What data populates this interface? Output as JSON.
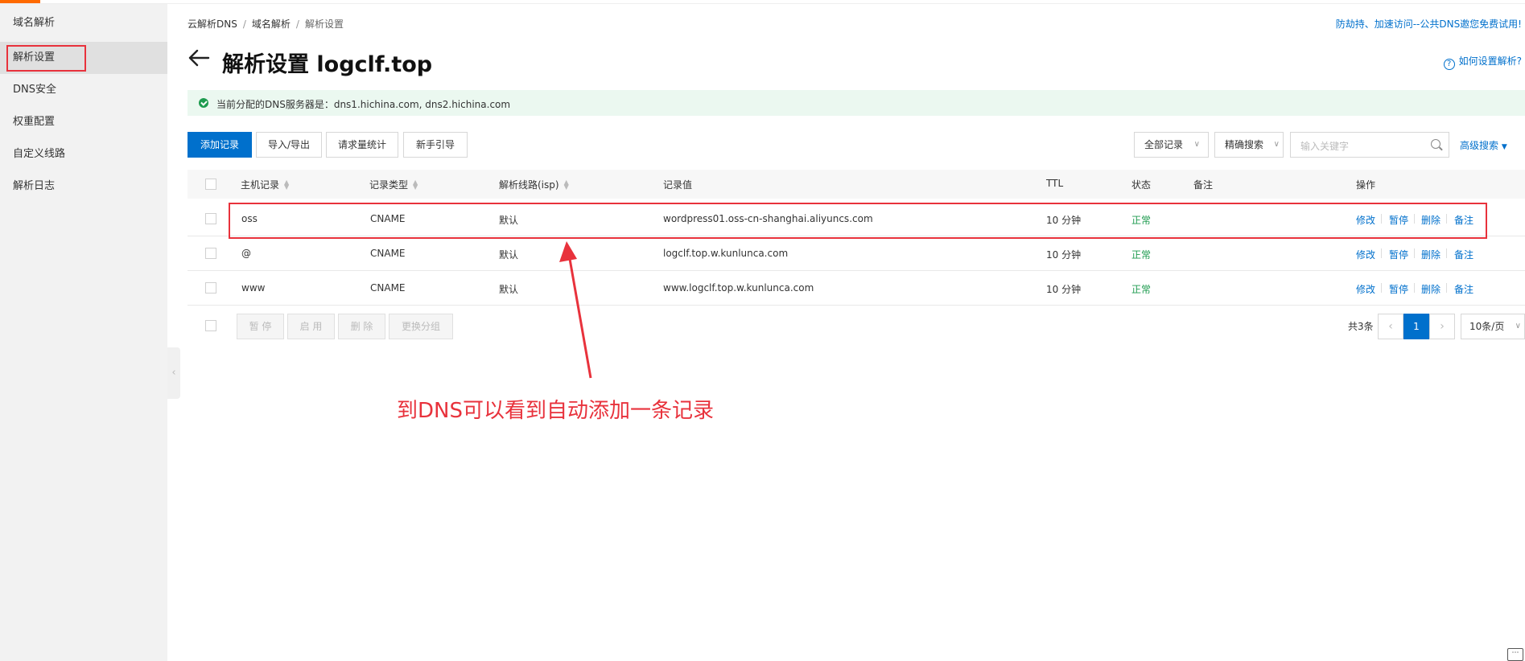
{
  "sidebar": {
    "items": [
      {
        "label": "域名解析"
      },
      {
        "label": "解析设置"
      },
      {
        "label": "DNS安全"
      },
      {
        "label": "权重配置"
      },
      {
        "label": "自定义线路"
      },
      {
        "label": "解析日志"
      }
    ]
  },
  "header": {
    "breadcrumb": [
      "云解析DNS",
      "域名解析",
      "解析设置"
    ],
    "promo": "防劫持、加速访问--公共DNS邀您免费试用!",
    "title": "解析设置 logclf.top",
    "help": "如何设置解析?"
  },
  "alert": {
    "message": "当前分配的DNS服务器是：dns1.hichina.com, dns2.hichina.com"
  },
  "toolbar": {
    "add": "添加记录",
    "import_export": "导入/导出",
    "stats": "请求量统计",
    "guide": "新手引导",
    "filter_all": "全部记录",
    "precise": "精确搜索",
    "search_placeholder": "输入关键字",
    "advanced": "高级搜索"
  },
  "table": {
    "headers": {
      "host": "主机记录",
      "type": "记录类型",
      "line": "解析线路(isp)",
      "value": "记录值",
      "ttl": "TTL",
      "status": "状态",
      "remark": "备注",
      "ops": "操作"
    },
    "rows": [
      {
        "host": "oss",
        "type": "CNAME",
        "line": "默认",
        "value": "wordpress01.oss-cn-shanghai.aliyuncs.com",
        "ttl": "10 分钟",
        "status": "正常"
      },
      {
        "host": "@",
        "type": "CNAME",
        "line": "默认",
        "value": "logclf.top.w.kunlunca.com",
        "ttl": "10 分钟",
        "status": "正常"
      },
      {
        "host": "www",
        "type": "CNAME",
        "line": "默认",
        "value": "www.logclf.top.w.kunlunca.com",
        "ttl": "10 分钟",
        "status": "正常"
      }
    ],
    "ops": {
      "edit": "修改",
      "pause": "暂停",
      "delete": "删除",
      "remark": "备注"
    }
  },
  "footer": {
    "pause": "暂 停",
    "enable": "启 用",
    "delete": "删 除",
    "change_group": "更换分组",
    "total": "共3条",
    "page": "1",
    "page_size": "10条/页"
  },
  "annotation": {
    "text": "到DNS可以看到自动添加一条记录",
    "color": "#e8323c"
  },
  "colors": {
    "primary": "#0070cc",
    "success": "#1e9b4f",
    "accent": "#ff6a00"
  }
}
